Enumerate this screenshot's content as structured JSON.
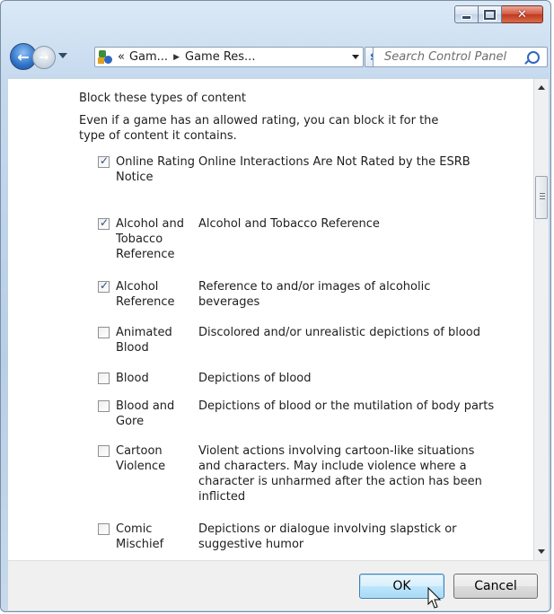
{
  "window": {
    "caption_buttons": [
      "minimize",
      "maximize",
      "close"
    ]
  },
  "nav": {
    "breadcrumb": [
      "Gam...",
      "Game Res..."
    ],
    "breadcrumb_prefix": "«",
    "search_placeholder": "Search Control Panel"
  },
  "content": {
    "heading": "Block these types of content",
    "description": "Even if a game has an allowed rating, you can block it for the type of content it contains.",
    "items": [
      {
        "label": "Online Rating Notice",
        "description": "Online Interactions Are Not Rated by the ESRB",
        "checked": true
      },
      {
        "label": "Alcohol and Tobacco Reference",
        "description": "Alcohol and Tobacco Reference",
        "checked": true
      },
      {
        "label": "Alcohol Reference",
        "description": "Reference to and/or images of alcoholic beverages",
        "checked": true
      },
      {
        "label": "Animated Blood",
        "description": "Discolored and/or unrealistic depictions of blood",
        "checked": false
      },
      {
        "label": "Blood",
        "description": "Depictions of blood",
        "checked": false
      },
      {
        "label": "Blood and Gore",
        "description": "Depictions of blood or the mutilation of body parts",
        "checked": false
      },
      {
        "label": "Cartoon Violence",
        "description": "Violent actions involving cartoon-like situations and characters. May include violence where a character is unharmed after the action has been inflicted",
        "checked": false
      },
      {
        "label": "Comic Mischief",
        "description": "Depictions or dialogue involving slapstick or suggestive humor",
        "checked": false
      }
    ]
  },
  "footer": {
    "ok_label": "OK",
    "cancel_label": "Cancel"
  },
  "colors": {
    "accent": "#3c7fb1",
    "close_button": "#c23a1e",
    "checkmark": "#2b4a85"
  }
}
